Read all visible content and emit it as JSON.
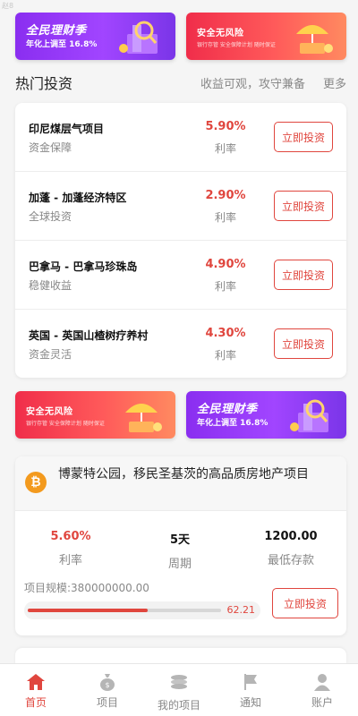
{
  "corner_text": "赵8",
  "banner_top": {
    "left": {
      "title": "全民理财季",
      "subtitle": "年化上调至 16.8%"
    },
    "right": {
      "title": "安全无风险",
      "subtitle": "银行存管 安全保障计划 随时保证"
    }
  },
  "section": {
    "title": "热门投资",
    "slogan": "收益可观，攻守兼备",
    "more": "更多"
  },
  "investments": [
    {
      "name": "印尼煤层气项目",
      "tag": "资金保障",
      "rate": "5.90%",
      "rate_label": "利率",
      "button": "立即投资"
    },
    {
      "name": "加蓬 - 加蓬经济特区",
      "tag": "全球投资",
      "rate": "2.90%",
      "rate_label": "利率",
      "button": "立即投资"
    },
    {
      "name": "巴拿马 - 巴拿马珍珠岛",
      "tag": "稳健收益",
      "rate": "4.90%",
      "rate_label": "利率",
      "button": "立即投资"
    },
    {
      "name": "英国 - 英国山楂树疗养村",
      "tag": "资金灵活",
      "rate": "4.30%",
      "rate_label": "利率",
      "button": "立即投资"
    }
  ],
  "banner_mid": {
    "left": {
      "title": "安全无风险",
      "subtitle": "银行存管 安全保障计划 随时保证"
    },
    "right": {
      "title": "全民理财季",
      "subtitle": "年化上调至 16.8%"
    }
  },
  "project": {
    "coin_symbol": "₿",
    "title": "博蒙特公园，移民圣基茨的高品质房地产项目",
    "stats": [
      {
        "value": "5.60%",
        "label": "利率"
      },
      {
        "value": "5天",
        "label": "周期"
      },
      {
        "value": "1200.00",
        "label": "最低存款"
      }
    ],
    "scale": "项目规模:380000000.00",
    "progress_percent": 62.21,
    "progress_text": "62.21",
    "button": "立即投资"
  },
  "tabs": [
    {
      "label": "首页",
      "icon": "home-icon",
      "active": true
    },
    {
      "label": "项目",
      "icon": "money-bag-icon",
      "active": false
    },
    {
      "label": "我的项目",
      "icon": "coins-stack-icon",
      "active": false
    },
    {
      "label": "通知",
      "icon": "flag-icon",
      "active": false
    },
    {
      "label": "账户",
      "icon": "user-icon",
      "active": false
    }
  ],
  "colors": {
    "accent": "#e0463e",
    "purple_banner": "#8a2ef0",
    "red_banner": "#f02d4a",
    "coin": "#f39a1e"
  }
}
